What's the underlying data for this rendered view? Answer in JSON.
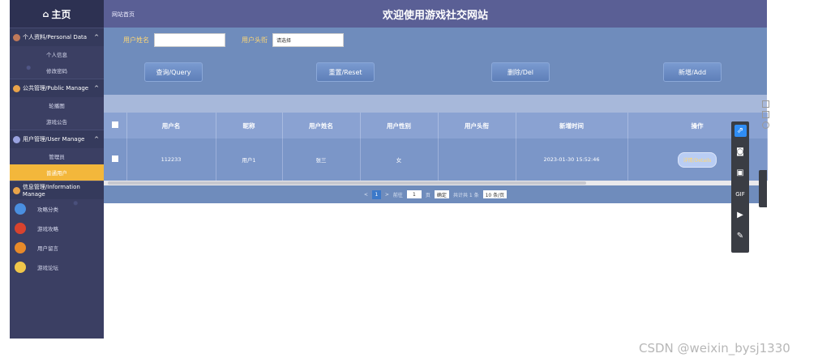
{
  "header": {
    "logo": "主页",
    "breadcrumb": "网站首页",
    "title": "欢迎使用游戏社交网站"
  },
  "sidebar": {
    "groups": [
      {
        "label": "个人资料/Personal Data",
        "items": [
          "个人信息",
          "修改密码"
        ]
      },
      {
        "label": "公共管理/Public Manage",
        "items": [
          "轮播图",
          "游戏公告"
        ]
      },
      {
        "label": "用户管理/User Manage",
        "items": [
          "管理员",
          "普通用户"
        ]
      },
      {
        "label": "信息管理/Information Manage",
        "items": [
          "攻略分类",
          "游戏攻略",
          "用户留言",
          "游戏论坛"
        ]
      }
    ],
    "active_item": "普通用户"
  },
  "filter": {
    "name_label": "用户姓名",
    "name_value": "",
    "avatar_label": "用户头衔",
    "avatar_value": "请选择"
  },
  "buttons": {
    "query": "查询/Query",
    "reset": "重置/Reset",
    "delete": "删除/Del",
    "add": "新增/Add"
  },
  "table": {
    "headers": [
      "用户名",
      "昵称",
      "用户姓名",
      "用户性别",
      "用户头衔",
      "新增时间",
      "操作"
    ],
    "rows": [
      {
        "username": "112233",
        "nickname": "用户1",
        "realname": "张三",
        "gender": "女",
        "title": "",
        "created": "2023-01-30 15:52:46",
        "action": "详情/Details"
      }
    ]
  },
  "pager": {
    "current": "1",
    "goto_label": "前往",
    "page_input": "1",
    "page_unit": "页",
    "confirm": "确定",
    "total": "共计共 1 条",
    "size": "10 条/页"
  },
  "footer": {
    "watermark": "CSDN @weixin_bysj1330"
  }
}
